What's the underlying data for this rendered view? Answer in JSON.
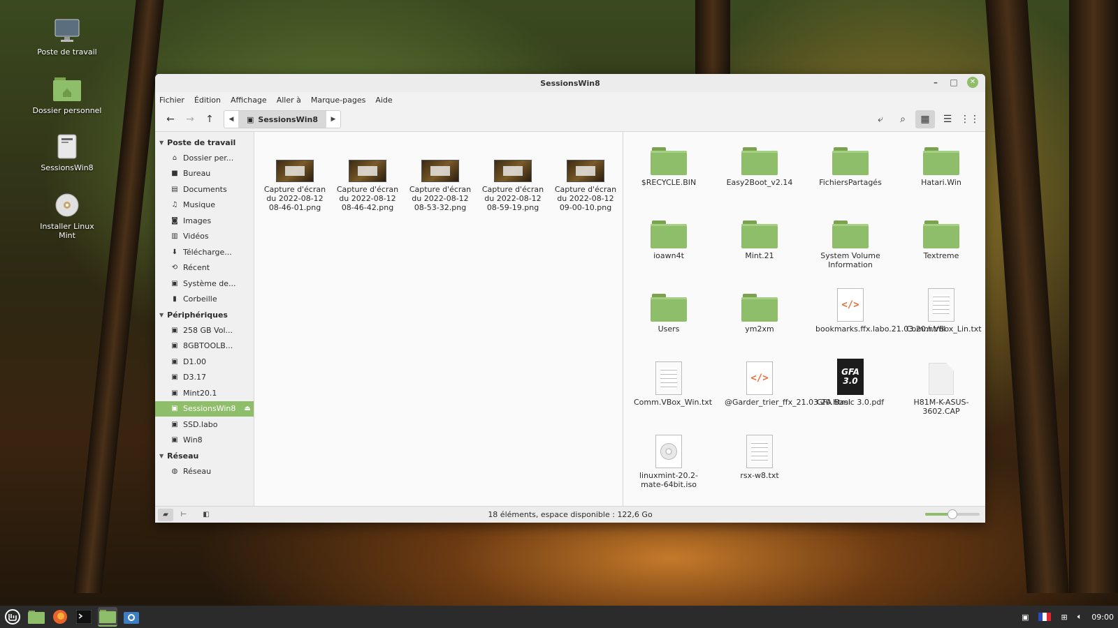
{
  "desktop": {
    "icons": [
      {
        "label": "Poste de travail"
      },
      {
        "label": "Dossier personnel"
      },
      {
        "label": "SessionsWin8"
      },
      {
        "label": "Installer Linux Mint"
      }
    ]
  },
  "window": {
    "title": "SessionsWin8",
    "controls": {
      "minimize": "–",
      "maximize": "□",
      "close": "✕"
    }
  },
  "menu": [
    "Fichier",
    "Édition",
    "Affichage",
    "Aller à",
    "Marque-pages",
    "Aide"
  ],
  "toolbar": {
    "location": "SessionsWin8"
  },
  "sidebar": {
    "sections": [
      {
        "title": "Poste de travail",
        "items": [
          "Dossier per...",
          "Bureau",
          "Documents",
          "Musique",
          "Images",
          "Vidéos",
          "Télécharge...",
          "Récent",
          "Système de...",
          "Corbeille"
        ]
      },
      {
        "title": "Périphériques",
        "items": [
          "258 GB Vol...",
          "8GBTOOLB...",
          "D1.00",
          "D3.17",
          "Mint20.1",
          "SessionsWin8",
          "SSD.labo",
          "Win8"
        ]
      },
      {
        "title": "Réseau",
        "items": [
          "Réseau"
        ]
      }
    ],
    "selected": "SessionsWin8"
  },
  "left_pane": {
    "files": [
      {
        "name": "Capture d'écran du 2022-08-12 08-46-01.png",
        "type": "screenshot"
      },
      {
        "name": "Capture d'écran du 2022-08-12 08-46-42.png",
        "type": "screenshot"
      },
      {
        "name": "Capture d'écran du 2022-08-12 08-53-32.png",
        "type": "screenshot"
      },
      {
        "name": "Capture d'écran du 2022-08-12 08-59-19.png",
        "type": "screenshot"
      },
      {
        "name": "Capture d'écran du 2022-08-12 09-00-10.png",
        "type": "screenshot"
      }
    ]
  },
  "right_pane": {
    "files": [
      {
        "name": "$RECYCLE.BIN",
        "type": "folder"
      },
      {
        "name": "Easy2Boot_v2.14",
        "type": "folder"
      },
      {
        "name": "FichiersPartagés",
        "type": "folder"
      },
      {
        "name": "Hatari.Win",
        "type": "folder"
      },
      {
        "name": "ioawn4t",
        "type": "folder"
      },
      {
        "name": "Mint.21",
        "type": "folder"
      },
      {
        "name": "System Volume Information",
        "type": "folder"
      },
      {
        "name": "Textreme",
        "type": "folder"
      },
      {
        "name": "Users",
        "type": "folder"
      },
      {
        "name": "ym2xm",
        "type": "folder"
      },
      {
        "name": "bookmarks.ffx.labo.21.03.20.html",
        "type": "html"
      },
      {
        "name": "Comm.VBox_Lin.txt",
        "type": "text"
      },
      {
        "name": "Comm.VBox_Win.txt",
        "type": "text"
      },
      {
        "name": "@Garder_trier_ffx_21.03.20.html",
        "type": "html"
      },
      {
        "name": "GFA Basic 3.0.pdf",
        "type": "pdf",
        "cover": "GFA 3.0"
      },
      {
        "name": "H81M-K-ASUS-3602.CAP",
        "type": "blank"
      },
      {
        "name": "linuxmint-20.2-mate-64bit.iso",
        "type": "iso"
      },
      {
        "name": "rsx-w8.txt",
        "type": "text"
      }
    ]
  },
  "statusbar": {
    "text": "18 éléments, espace disponible : 122,6 Go",
    "zoom_fraction": 0.5
  },
  "taskbar": {
    "clock": "09:00"
  },
  "colors": {
    "accent": "#8fbe6a",
    "folder": "#8fbe6a",
    "taskbar": "#2b2b2b"
  }
}
